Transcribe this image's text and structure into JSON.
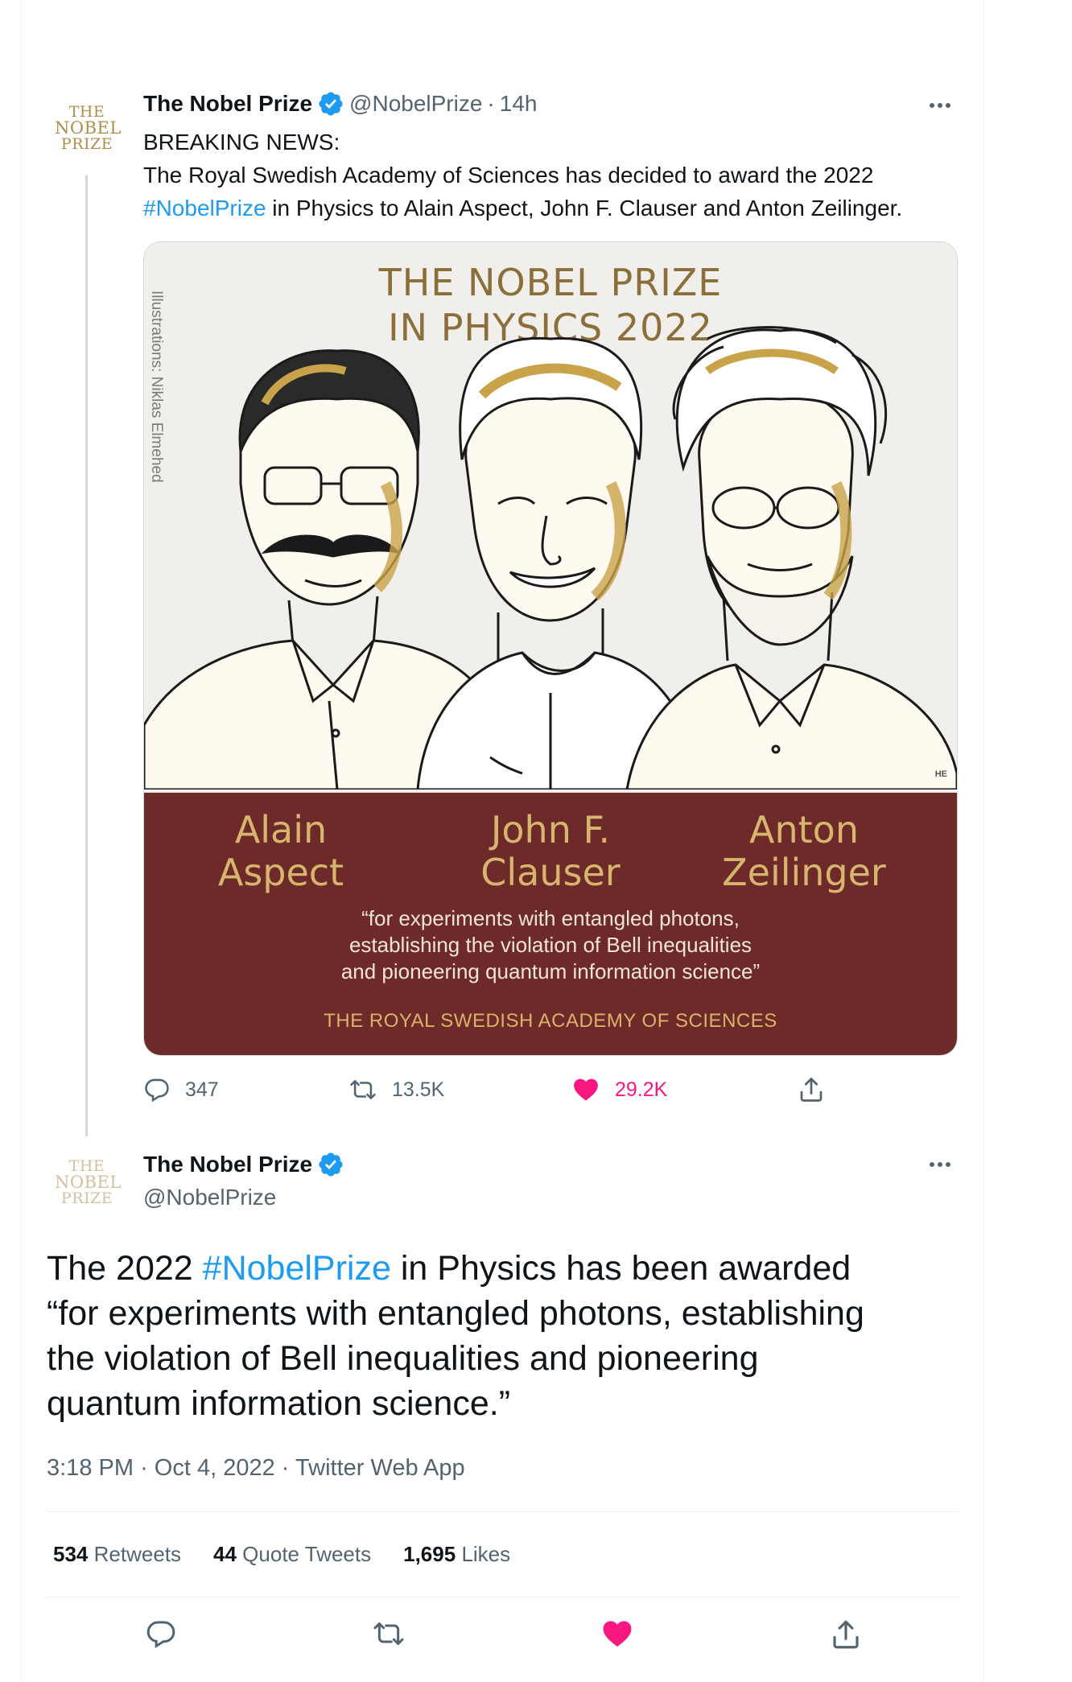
{
  "tweet1": {
    "avatar_lines": [
      "THE",
      "NOBEL",
      "PRIZE"
    ],
    "display_name": "The Nobel Prize",
    "handle": "@NobelPrize",
    "separator": "·",
    "age": "14h",
    "text_lines": [
      {
        "plain": "BREAKING NEWS:"
      },
      {
        "plain": "The Royal Swedish Academy of Sciences has decided to award the 2022"
      },
      {
        "hashtag": "#NobelPrize",
        "rest": " in Physics to Alain Aspect, John F. Clauser and Anton Zeilinger."
      }
    ],
    "media": {
      "title_lines": [
        "THE NOBEL PRIZE",
        "IN PHYSICS 2022"
      ],
      "credit": "Illustrations: Niklas Elmehed",
      "corner_mark": "HE",
      "laureates": [
        {
          "first": "Alain",
          "last": "Aspect"
        },
        {
          "first": "John F.",
          "last": "Clauser"
        },
        {
          "first": "Anton",
          "last": "Zeilinger"
        }
      ],
      "citation_lines": [
        "“for experiments with entangled photons,",
        "establishing the violation of Bell inequalities",
        "and pioneering quantum information science”"
      ],
      "academy": "THE ROYAL SWEDISH ACADEMY OF SCIENCES",
      "colors": {
        "band": "#6e2a29",
        "gold": "#d6b56f",
        "paper": "#f1efeb"
      }
    },
    "actions": {
      "replies": "347",
      "retweets": "13.5K",
      "likes": "29.2K"
    }
  },
  "tweet2": {
    "avatar_lines": [
      "THE",
      "NOBEL",
      "PRIZE"
    ],
    "display_name": "The Nobel Prize",
    "handle": "@NobelPrize",
    "text_lines": [
      {
        "pre": "The 2022 ",
        "hashtag": "#NobelPrize",
        "rest": " in Physics has been awarded"
      },
      {
        "plain": "“for experiments with entangled photons, establishing"
      },
      {
        "plain": "the violation of Bell inequalities and pioneering"
      },
      {
        "plain": "quantum information science.”"
      }
    ],
    "meta": {
      "time": "3:18 PM",
      "date": "Oct 4, 2022",
      "source": "Twitter Web App",
      "separator": "·"
    },
    "stats": {
      "retweets_count": "534",
      "retweets_label": "Retweets",
      "quotes_count": "44",
      "quotes_label": "Quote Tweets",
      "likes_count": "1,695",
      "likes_label": "Likes"
    }
  },
  "icons": {
    "reply": "reply-icon",
    "retweet": "retweet-icon",
    "like": "heart-filled-icon",
    "share": "share-icon",
    "verified": "verified-badge-icon",
    "more": "more-horizontal-icon"
  },
  "colors": {
    "link": "#1d9bf0",
    "like": "#f91880",
    "secondary_text": "#536471",
    "verified": "#1d9bf0",
    "logo_gold": "#b08d4a"
  }
}
